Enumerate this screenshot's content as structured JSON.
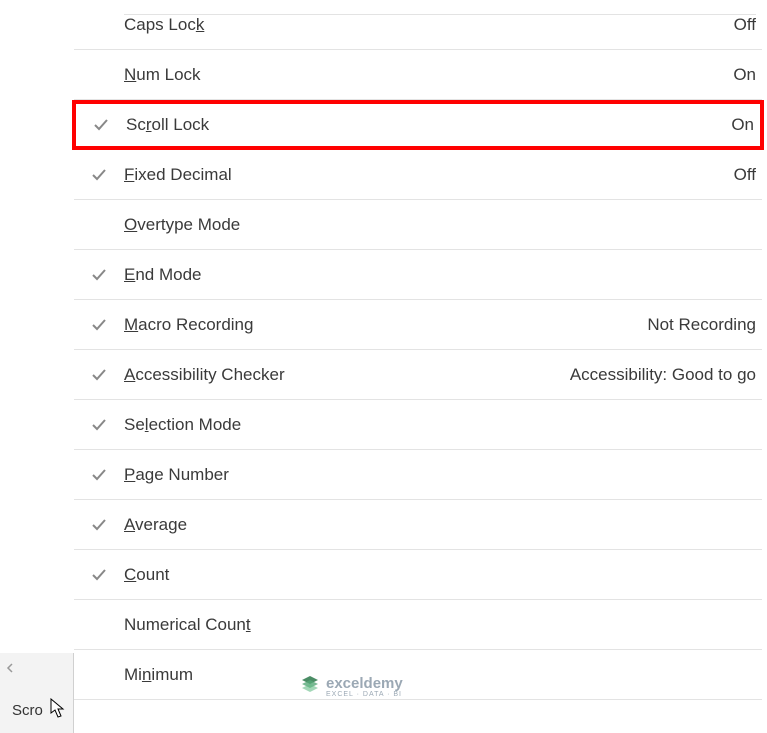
{
  "menu": {
    "items": [
      {
        "checked": false,
        "label_pre": "Caps Loc",
        "label_u": "k",
        "label_post": "",
        "value": "Off"
      },
      {
        "checked": false,
        "label_pre": "",
        "label_u": "N",
        "label_post": "um Lock",
        "value": "On"
      },
      {
        "checked": true,
        "label_pre": "Sc",
        "label_u": "r",
        "label_post": "oll Lock",
        "value": "On",
        "highlighted": true
      },
      {
        "checked": true,
        "label_pre": "",
        "label_u": "F",
        "label_post": "ixed Decimal",
        "value": "Off"
      },
      {
        "checked": false,
        "label_pre": "",
        "label_u": "O",
        "label_post": "vertype Mode",
        "value": ""
      },
      {
        "checked": true,
        "label_pre": "",
        "label_u": "E",
        "label_post": "nd Mode",
        "value": ""
      },
      {
        "checked": true,
        "label_pre": "",
        "label_u": "M",
        "label_post": "acro Recording",
        "value": "Not Recording"
      },
      {
        "checked": true,
        "label_pre": "",
        "label_u": "A",
        "label_post": "ccessibility Checker",
        "value": "Accessibility: Good to go"
      },
      {
        "checked": true,
        "label_pre": "Se",
        "label_u": "l",
        "label_post": "ection Mode",
        "value": ""
      },
      {
        "checked": true,
        "label_pre": "",
        "label_u": "P",
        "label_post": "age Number",
        "value": ""
      },
      {
        "checked": true,
        "label_pre": "",
        "label_u": "A",
        "label_post": "verage",
        "value": ""
      },
      {
        "checked": true,
        "label_pre": "",
        "label_u": "C",
        "label_post": "ount",
        "value": ""
      },
      {
        "checked": false,
        "label_pre": "Numerical Coun",
        "label_u": "t",
        "label_post": "",
        "value": ""
      },
      {
        "checked": false,
        "label_pre": "Mi",
        "label_u": "n",
        "label_post": "imum",
        "value": ""
      }
    ]
  },
  "statusbar": {
    "text": "Scro"
  },
  "watermark": {
    "main": "exceldemy",
    "sub": "EXCEL · DATA · BI"
  }
}
